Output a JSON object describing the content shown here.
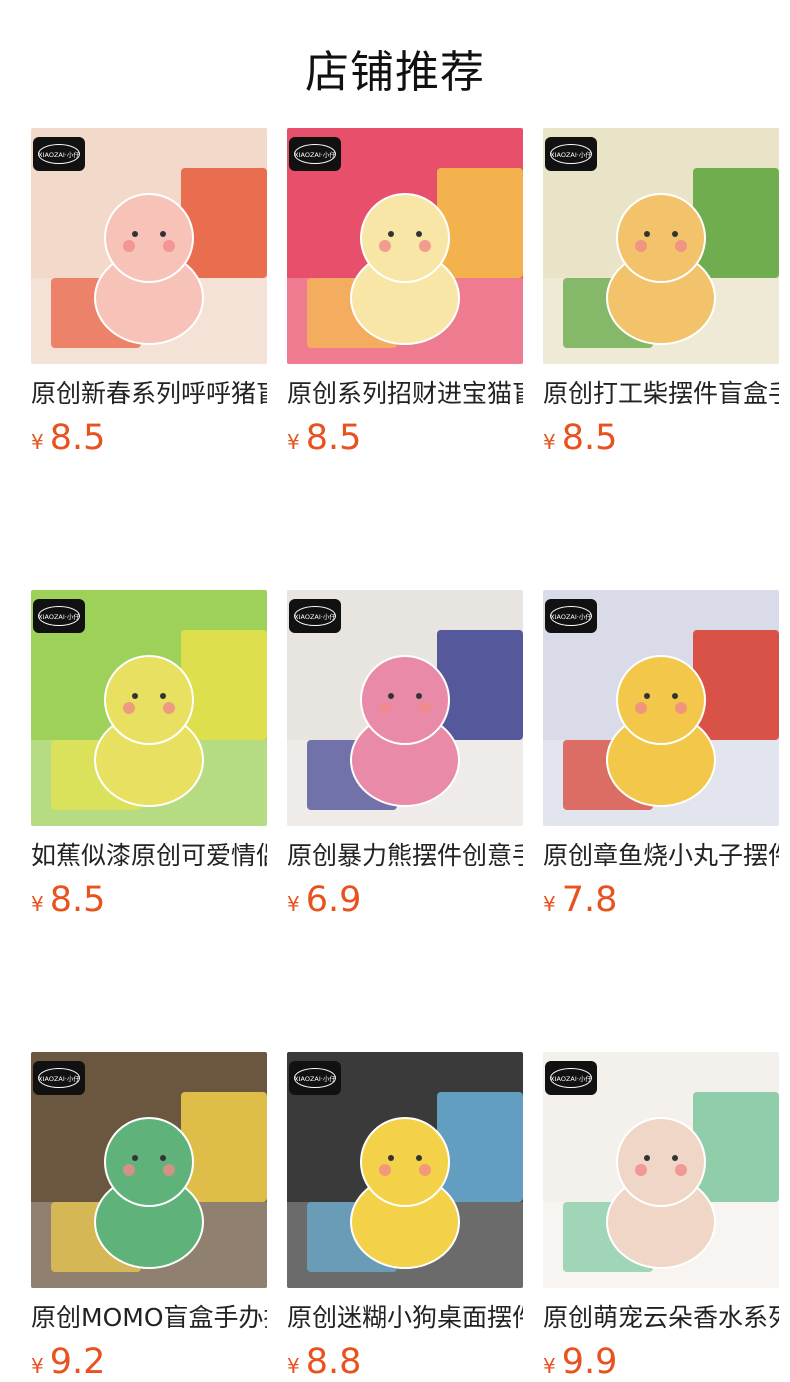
{
  "page": {
    "title": "店铺推荐"
  },
  "brand_badge_text": "XIAOZAI·小仔",
  "currency_symbol": "¥",
  "products": [
    {
      "title": "原创新春系列呼呼猪盲盒",
      "price": "8.5",
      "bg": "#f2d9c9",
      "accent": "#e85a3a",
      "figure": "#f7c3b8"
    },
    {
      "title": "原创系列招财进宝猫盲盒",
      "price": "8.5",
      "bg": "#e84f6b",
      "accent": "#f6c34a",
      "figure": "#f8e6a6"
    },
    {
      "title": "原创打工柴摆件盲盒手办",
      "price": "8.5",
      "bg": "#e9e3c8",
      "accent": "#5aa33a",
      "figure": "#f2c36a"
    },
    {
      "title": "如蕉似漆原创可爱情侣摆件",
      "price": "8.5",
      "bg": "#9ed15a",
      "accent": "#e9e24a",
      "figure": "#e8e060"
    },
    {
      "title": "原创暴力熊摆件创意手办",
      "price": "6.9",
      "bg": "#e8e4e0",
      "accent": "#3c3f8f",
      "figure": "#e98aa8"
    },
    {
      "title": "原创章鱼烧小丸子摆件盲盒",
      "price": "7.8",
      "bg": "#d9dce8",
      "accent": "#d83a2a",
      "figure": "#f3c84a"
    },
    {
      "title": "原创MOMO盲盒手办摆件",
      "price": "9.2",
      "bg": "#6b5640",
      "accent": "#f2cf4a",
      "figure": "#5fb37a"
    },
    {
      "title": "原创迷糊小狗桌面摆件",
      "price": "8.8",
      "bg": "#3b3a3a",
      "accent": "#6ab0d8",
      "figure": "#f3d24a"
    },
    {
      "title": "原创萌宠云朵香水系列",
      "price": "9.9",
      "bg": "#f4f0ec",
      "accent": "#7cc7a0",
      "figure": "#f0d6c6"
    }
  ]
}
